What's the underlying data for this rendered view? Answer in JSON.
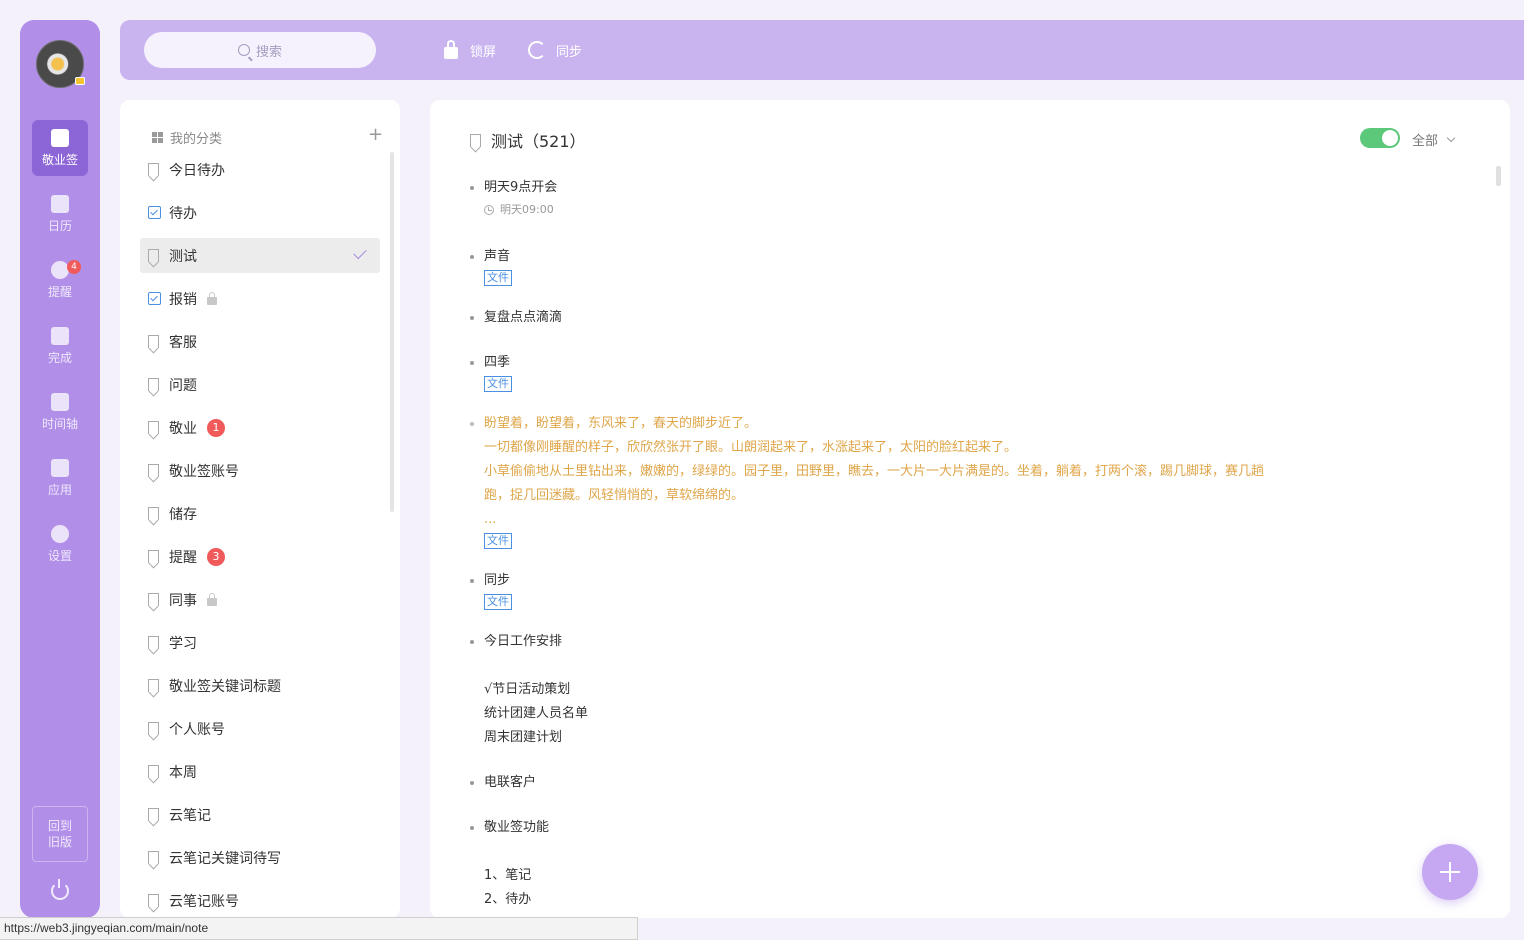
{
  "rail": {
    "items": [
      {
        "label": "敬业签",
        "icon": "cloud-note-icon"
      },
      {
        "label": "日历",
        "icon": "calendar-icon"
      },
      {
        "label": "提醒",
        "icon": "bell-icon",
        "badge": "4"
      },
      {
        "label": "完成",
        "icon": "done-icon"
      },
      {
        "label": "时间轴",
        "icon": "timeline-icon"
      },
      {
        "label": "应用",
        "icon": "apps-icon"
      },
      {
        "label": "设置",
        "icon": "gear-icon"
      }
    ],
    "back_label": "回到旧版"
  },
  "topbar": {
    "search_placeholder": "搜索",
    "lock_label": "锁屏",
    "sync_label": "同步"
  },
  "categories": {
    "header": "我的分类",
    "add": "+",
    "items": [
      {
        "label": "今日待办"
      },
      {
        "label": "待办",
        "todo": true
      },
      {
        "label": "测试",
        "selected": true
      },
      {
        "label": "报销",
        "todo": true,
        "locked": true
      },
      {
        "label": "客服"
      },
      {
        "label": "问题"
      },
      {
        "label": "敬业",
        "badge": "1"
      },
      {
        "label": "敬业签账号"
      },
      {
        "label": "储存"
      },
      {
        "label": "提醒",
        "badge": "3"
      },
      {
        "label": "同事",
        "locked": true
      },
      {
        "label": "学习"
      },
      {
        "label": "敬业签关键词标题"
      },
      {
        "label": "个人账号"
      },
      {
        "label": "本周"
      },
      {
        "label": "云笔记"
      },
      {
        "label": "云笔记关键词待写"
      },
      {
        "label": "云笔记账号"
      }
    ]
  },
  "notes": {
    "title": "测试（521）",
    "filter": "全部",
    "file_tag": "文件",
    "items": [
      {
        "lines": [
          "明天9点开会"
        ],
        "time": "明天09:00"
      },
      {
        "lines": [
          "声音"
        ],
        "file": true
      },
      {
        "lines": [
          "复盘点点滴滴"
        ]
      },
      {
        "lines": [
          "四季"
        ],
        "file": true
      },
      {
        "lines": [
          "盼望着，盼望着，东风来了，春天的脚步近了。",
          "一切都像刚睡醒的样子，欣欣然张开了眼。山朗润起来了，水涨起来了，太阳的脸红起来了。",
          "小草偷偷地从土里钻出来，嫩嫩的，绿绿的。园子里，田野里，瞧去，一大片一大片满是的。坐着，躺着，打两个滚，踢几脚球，赛几趟",
          "跑，捉几回迷藏。风轻悄悄的，草软绵绵的。",
          "..."
        ],
        "file": true,
        "highlight": true
      },
      {
        "lines": [
          "同步"
        ],
        "file": true
      },
      {
        "lines": [
          "今日工作安排",
          "",
          "√节日活动策划",
          "统计团建人员名单",
          "周末团建计划"
        ]
      },
      {
        "lines": [
          "电联客户"
        ]
      },
      {
        "lines": [
          "敬业签功能",
          "",
          "1、笔记",
          "2、待办"
        ]
      }
    ]
  },
  "status_url": "https://web3.jingyeqian.com/main/note"
}
